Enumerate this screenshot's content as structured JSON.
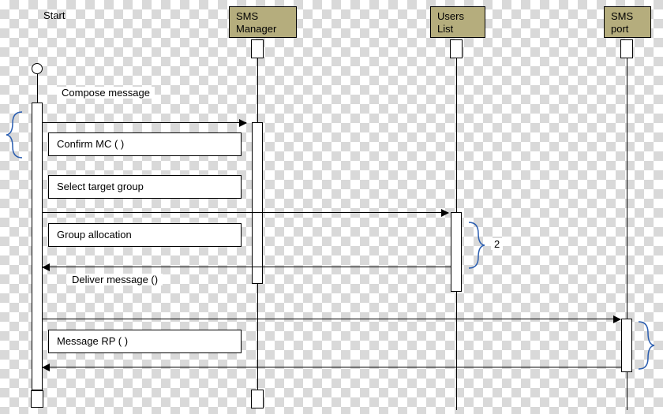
{
  "start_label": "Start",
  "lifelines": {
    "sms_manager": "SMS Manager",
    "users_list": "Users List",
    "sms_port": "SMS port"
  },
  "messages": {
    "compose": "Compose message",
    "confirm_mc": "Confirm MC ( )",
    "select_target": "Select target group",
    "group_allocation": "Group allocation",
    "deliver_message": "Deliver message ()",
    "message_rp": "Message RP ( )"
  },
  "annotation": {
    "two": "2"
  }
}
